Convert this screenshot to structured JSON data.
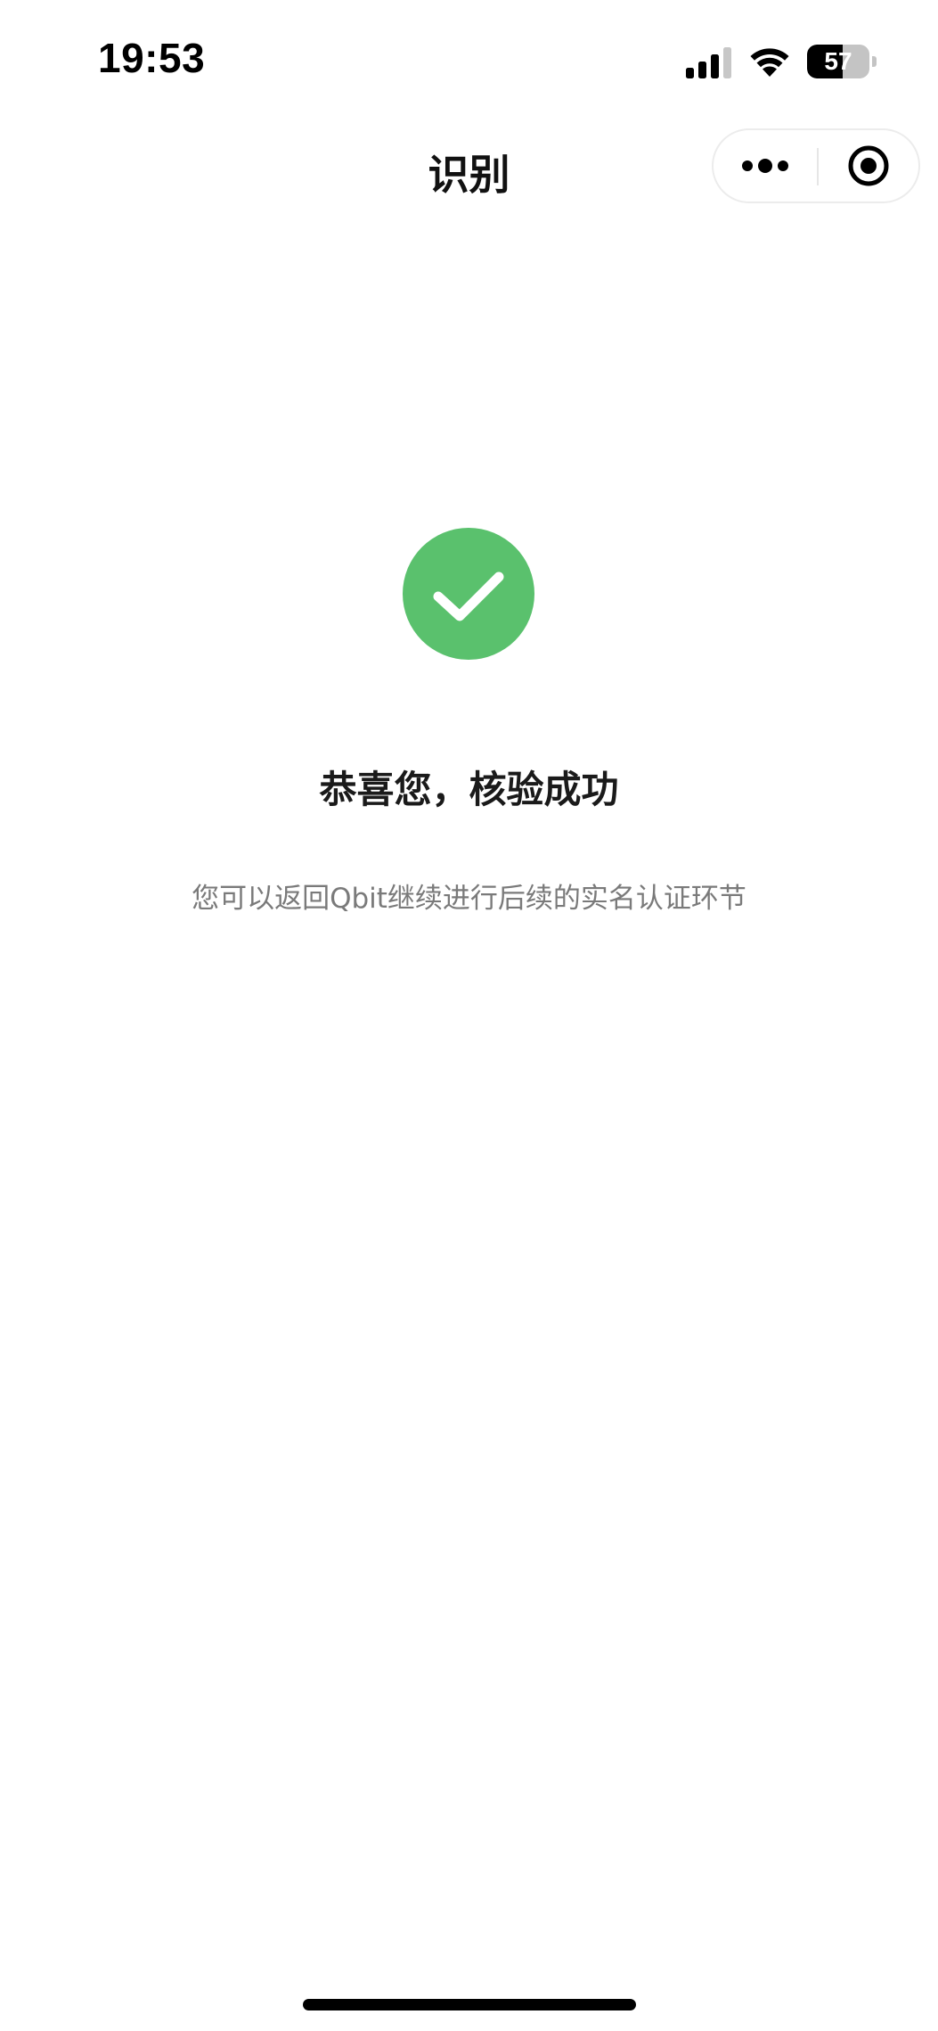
{
  "status_bar": {
    "time": "19:53",
    "battery_level": "57",
    "battery_fraction": 0.57,
    "signal_icon": "cellular-signal-icon",
    "wifi_icon": "wifi-icon"
  },
  "nav": {
    "title": "识别",
    "more_icon": "more-dots-icon",
    "close_icon": "target-close-icon"
  },
  "result": {
    "icon": "check-circle-icon",
    "icon_color": "#5ac16d",
    "title": "恭喜您，核验成功",
    "description": "您可以返回Qbit继续进行后续的实名认证环节"
  }
}
